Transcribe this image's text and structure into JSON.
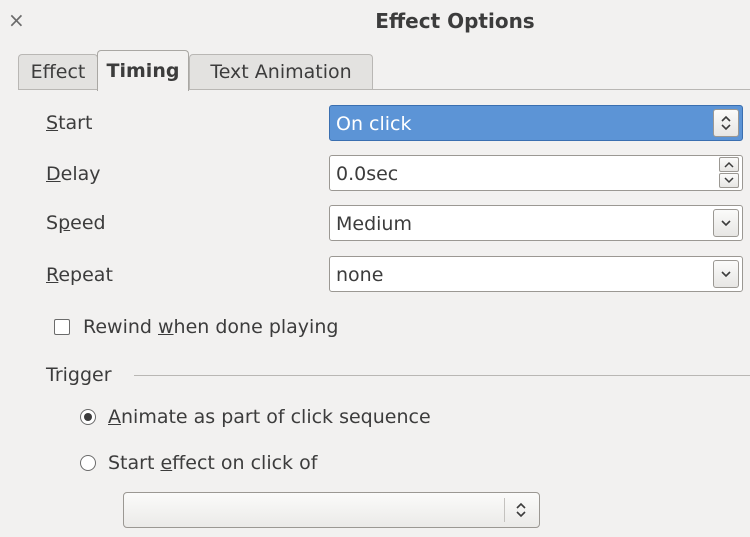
{
  "window": {
    "title": "Effect Options",
    "close_glyph": "×"
  },
  "tabs": [
    {
      "label": "Effect",
      "active": false
    },
    {
      "label": "Timing",
      "active": true
    },
    {
      "label": "Text Animation",
      "active": false
    }
  ],
  "timing": {
    "start": {
      "label_pre": "",
      "label_mnemonic": "S",
      "label_post": "tart",
      "value": "On click"
    },
    "delay": {
      "label_pre": "",
      "label_mnemonic": "D",
      "label_post": "elay",
      "value": "0.0sec"
    },
    "speed": {
      "label_pre": "S",
      "label_mnemonic": "p",
      "label_post": "eed",
      "value": "Medium"
    },
    "repeat": {
      "label_pre": "",
      "label_mnemonic": "R",
      "label_post": "epeat",
      "value": "none"
    },
    "rewind": {
      "label_pre": "Rewind ",
      "label_mnemonic": "w",
      "label_post": "hen done playing",
      "checked": false
    }
  },
  "trigger": {
    "group_label": "Trigger",
    "animate_option": {
      "label_pre": "",
      "label_mnemonic": "A",
      "label_post": "nimate as part of click sequence",
      "selected": true
    },
    "start_on_click_option": {
      "label_pre": "Start ",
      "label_mnemonic": "e",
      "label_post": "ffect on click of",
      "selected": false
    },
    "shape_combo_value": ""
  },
  "icons": {
    "close": "close-icon",
    "spin": "up-down-chevron-icon",
    "dropdown": "chevron-down-icon"
  },
  "colors": {
    "selection": "#5c94d6",
    "background": "#f2f1f0"
  }
}
